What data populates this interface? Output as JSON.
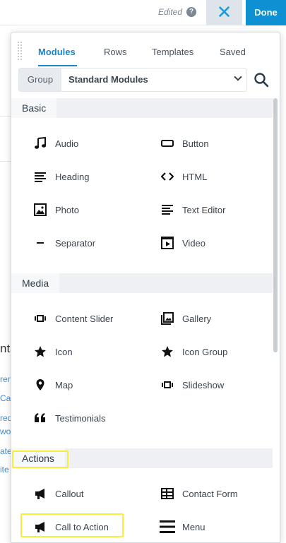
{
  "topbar": {
    "edited_label": "Edited",
    "help_icon": "?",
    "close_icon": "✕",
    "done_label": "Done"
  },
  "panel": {
    "tabs": [
      {
        "label": "Modules",
        "active": true
      },
      {
        "label": "Rows",
        "active": false
      },
      {
        "label": "Templates",
        "active": false
      },
      {
        "label": "Saved",
        "active": false
      }
    ],
    "group": {
      "label": "Group",
      "value": "Standard Modules"
    },
    "sections": [
      {
        "title": "Basic",
        "modules": [
          {
            "label": "Audio",
            "icon": "music-note-icon"
          },
          {
            "label": "Button",
            "icon": "button-icon"
          },
          {
            "label": "Heading",
            "icon": "heading-icon"
          },
          {
            "label": "HTML",
            "icon": "code-icon"
          },
          {
            "label": "Photo",
            "icon": "photo-icon"
          },
          {
            "label": "Text Editor",
            "icon": "text-editor-icon"
          },
          {
            "label": "Separator",
            "icon": "separator-icon"
          },
          {
            "label": "Video",
            "icon": "video-icon"
          }
        ]
      },
      {
        "title": "Media",
        "modules": [
          {
            "label": "Content Slider",
            "icon": "slider-icon"
          },
          {
            "label": "Gallery",
            "icon": "gallery-icon"
          },
          {
            "label": "Icon",
            "icon": "star-icon"
          },
          {
            "label": "Icon Group",
            "icon": "star-icon"
          },
          {
            "label": "Map",
            "icon": "map-pin-icon"
          },
          {
            "label": "Slideshow",
            "icon": "slider-icon"
          },
          {
            "label": "Testimonials",
            "icon": "quote-icon"
          }
        ]
      },
      {
        "title": "Actions",
        "modules": [
          {
            "label": "Callout",
            "icon": "megaphone-icon"
          },
          {
            "label": "Contact Form",
            "icon": "form-icon"
          },
          {
            "label": "Call to Action",
            "icon": "megaphone-icon"
          },
          {
            "label": "Menu",
            "icon": "menu-icon"
          }
        ]
      }
    ]
  },
  "background_page": {
    "heading_fragment": "nts",
    "link_fragments": [
      "ren",
      "Cas",
      "red",
      "wor",
      "ate",
      "ite"
    ]
  },
  "colors": {
    "accent": "#1c86c8",
    "done_bg": "#0e90d2",
    "highlight": "#f5ef3a"
  }
}
